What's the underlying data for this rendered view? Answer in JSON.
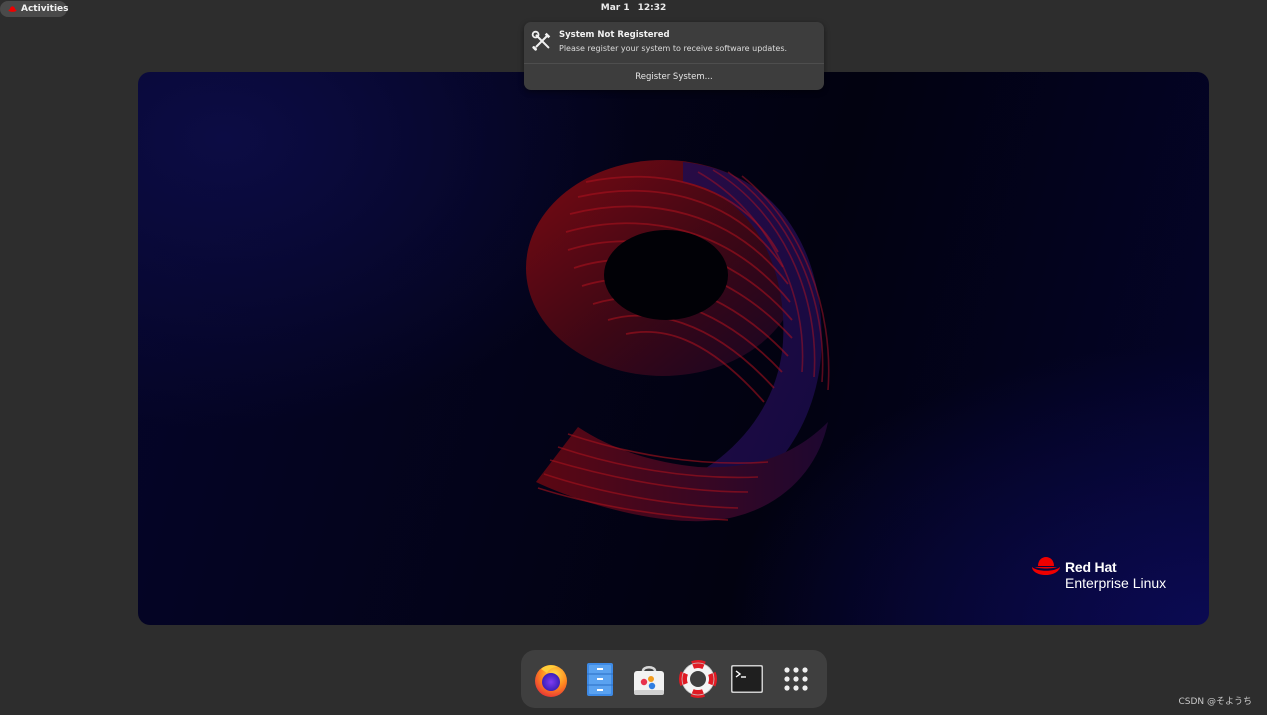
{
  "top_bar": {
    "activities_label": "Activities",
    "clock_date": "Mar 1",
    "clock_time": "12:32"
  },
  "notification": {
    "icon": "tools-icon",
    "title": "System Not Registered",
    "body": "Please register your system to receive software updates.",
    "action_label": "Register System..."
  },
  "wallpaper": {
    "version_numeral": "9",
    "brand_name": "Red Hat",
    "product_name": "Enterprise Linux",
    "brand_color": "#ee0000"
  },
  "dash": {
    "apps": [
      {
        "icon": "firefox-icon"
      },
      {
        "icon": "files-icon"
      },
      {
        "icon": "software-center-icon"
      },
      {
        "icon": "help-icon"
      },
      {
        "icon": "terminal-icon"
      },
      {
        "icon": "app-grid-icon"
      }
    ]
  },
  "watermark": "CSDN @そようち"
}
